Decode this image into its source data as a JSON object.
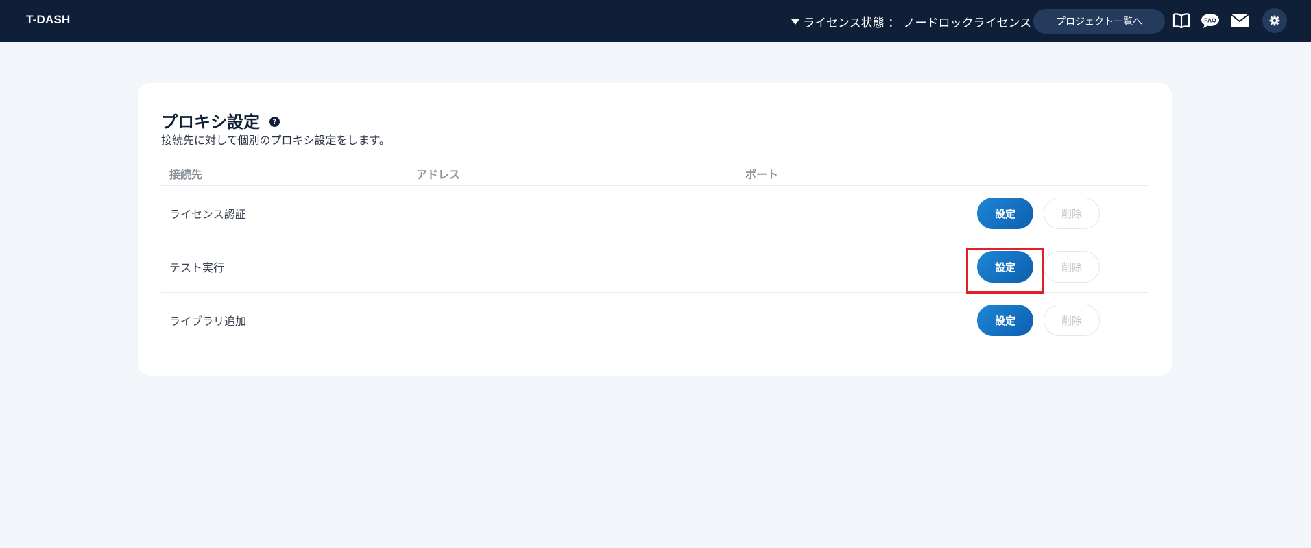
{
  "header": {
    "brand": "T-DASH",
    "license_text": "ライセンス状態 ： ノードロックライセンス",
    "project_button": "プロジェクト一覧へ",
    "icons": [
      "book-icon",
      "faq-icon",
      "mail-icon",
      "gear-icon"
    ],
    "faq_text": "FAQ"
  },
  "card": {
    "title": "プロキシ設定",
    "help": "?",
    "subtitle": "接続先に対して個別のプロキシ設定をします。",
    "columns": [
      "接続先",
      "アドレス",
      "ポート"
    ],
    "rows": [
      {
        "label": "ライセンス認証",
        "set": "設定",
        "delete": "削除"
      },
      {
        "label": "テスト実行",
        "set": "設定",
        "delete": "削除"
      },
      {
        "label": "ライブラリ追加",
        "set": "設定",
        "delete": "削除"
      }
    ]
  },
  "colors": {
    "header_bg": "#0f1f38",
    "primary_button": "#1a74c4",
    "highlight": "#e0202a",
    "page_bg": "#f2f6fa"
  }
}
